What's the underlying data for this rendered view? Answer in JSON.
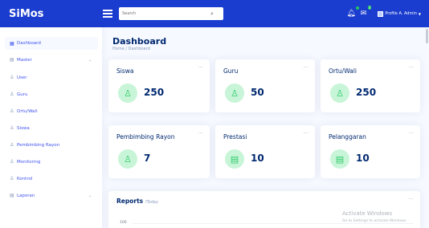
{
  "app": {
    "brand": "SiMos"
  },
  "search": {
    "placeholder": "Search"
  },
  "header": {
    "profile_name": "Profile A. Admin"
  },
  "sidebar": {
    "items": [
      {
        "label": "Dashboard",
        "icon": "grid-icon"
      },
      {
        "label": "Master",
        "icon": "menu-icon"
      },
      {
        "label": "User",
        "icon": "person-icon"
      },
      {
        "label": "Guru",
        "icon": "person-icon"
      },
      {
        "label": "Ortu/Wali",
        "icon": "person-icon"
      },
      {
        "label": "Siswa",
        "icon": "person-icon"
      },
      {
        "label": "Pembimbing Rayon",
        "icon": "person-icon"
      },
      {
        "label": "Monitoring",
        "icon": "person-icon"
      },
      {
        "label": "Kontrol",
        "icon": "person-icon"
      },
      {
        "label": "Laporan",
        "icon": "menu-icon"
      }
    ]
  },
  "page": {
    "title": "Dashboard",
    "breadcrumb_home": "Home",
    "breadcrumb_sep": "/",
    "breadcrumb_current": "Dashboard"
  },
  "cards": [
    {
      "title": "Siswa",
      "value": "250",
      "icon": "people-icon"
    },
    {
      "title": "Guru",
      "value": "50",
      "icon": "people-icon"
    },
    {
      "title": "Ortu/Wali",
      "value": "250",
      "icon": "people-icon"
    },
    {
      "title": "Pembimbing Rayon",
      "value": "7",
      "icon": "people-icon"
    },
    {
      "title": "Prestasi",
      "value": "10",
      "icon": "document-icon"
    },
    {
      "title": "Pelanggaran",
      "value": "10",
      "icon": "document-icon"
    }
  ],
  "reports": {
    "title": "Reports",
    "subtitle": "/Today",
    "ytick": "100"
  },
  "watermark": {
    "line1": "Activate Windows",
    "line2": "Go to Settings to activate Windows."
  },
  "colors": {
    "topbar": "#1b3dcf",
    "accent": "#4154f1",
    "card_icon_bg": "#c8f5d8",
    "card_icon_fg": "#2eca6a"
  }
}
